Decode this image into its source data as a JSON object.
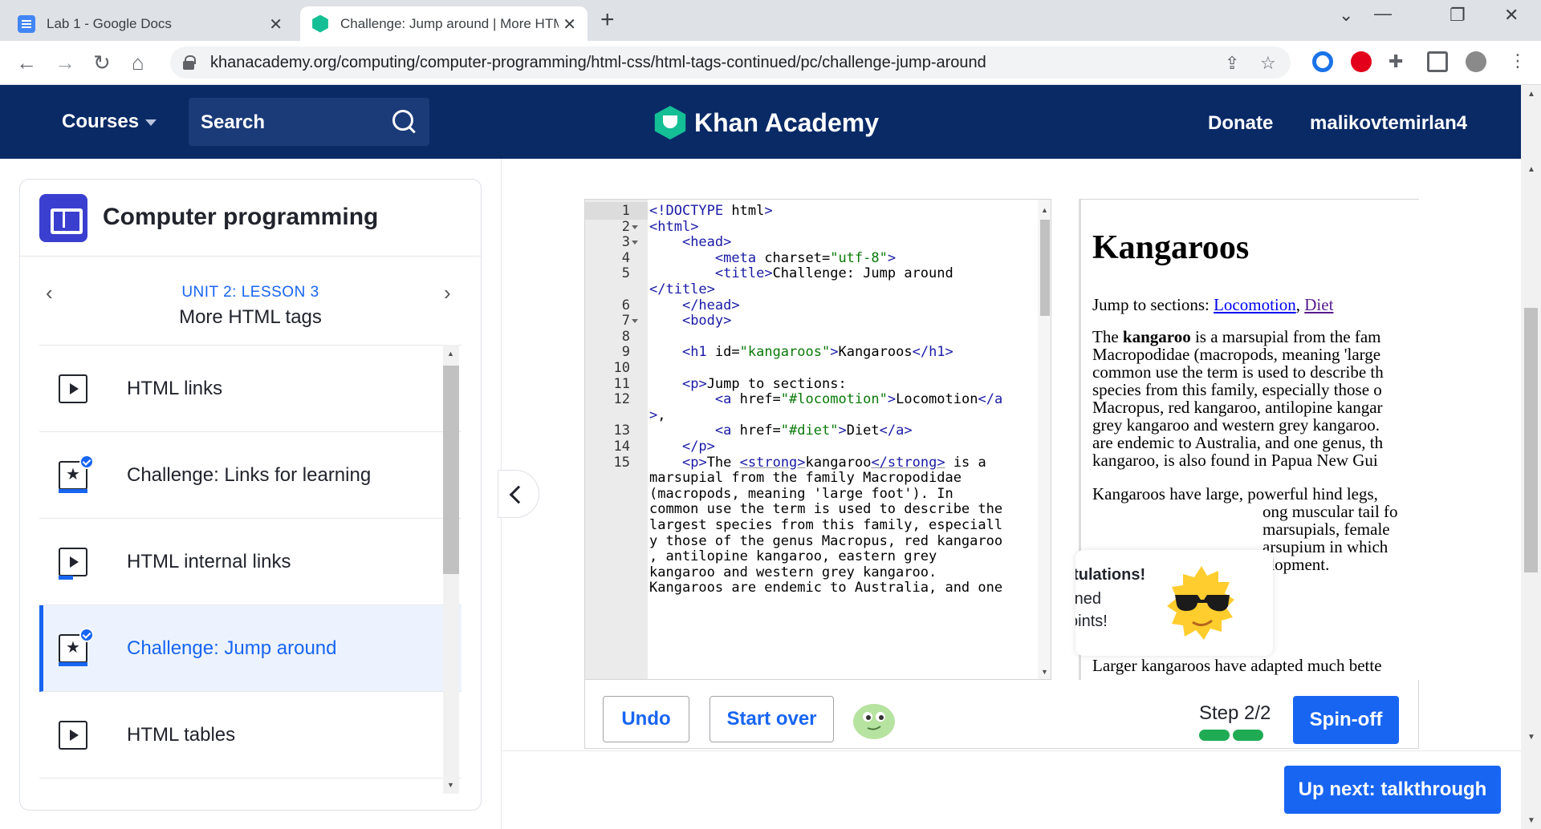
{
  "browser": {
    "tabs": [
      {
        "title": "Lab 1 - Google Docs",
        "favicon": "google-docs-icon"
      },
      {
        "title": "Challenge: Jump around | More HTML tags",
        "favicon": "khan-academy-icon"
      }
    ],
    "url": "khanacademy.org/computing/computer-programming/html-css/html-tags-continued/pc/challenge-jump-around"
  },
  "header": {
    "courses_label": "Courses",
    "search_label": "Search",
    "logo_text": "Khan Academy",
    "donate_label": "Donate",
    "username": "malikovtemirlan4",
    "bg_color": "#0a2a66"
  },
  "sidebar": {
    "course_title": "Computer programming",
    "unit_label": "UNIT 2: LESSON 3",
    "lesson_title": "More HTML tags",
    "items": [
      {
        "label": "HTML links",
        "type": "video",
        "completed": false
      },
      {
        "label": "Challenge: Links for learning",
        "type": "challenge",
        "completed": true
      },
      {
        "label": "HTML internal links",
        "type": "video",
        "completed": false
      },
      {
        "label": "Challenge: Jump around",
        "type": "challenge",
        "completed": true,
        "active": true
      },
      {
        "label": "HTML tables",
        "type": "video",
        "completed": false
      }
    ]
  },
  "editor": {
    "line_numbers": [
      "1",
      "2",
      "3",
      "4",
      "5",
      "",
      "6",
      "7",
      "8",
      "9",
      "10",
      "11",
      "12",
      "",
      "13",
      "14",
      "15"
    ],
    "code_lines": [
      "<!DOCTYPE html>",
      "<html>",
      "    <head>",
      "        <meta charset=\"utf-8\">",
      "        <title>Challenge: Jump around",
      "</title>",
      "    </head>",
      "    <body>",
      "",
      "    <h1 id=\"kangaroos\">Kangaroos</h1>",
      "",
      "    <p>Jump to sections:",
      "        <a href=\"#locomotion\">Locomotion</a",
      ">,",
      "        <a href=\"#diet\">Diet</a>",
      "    </p>",
      "    <p>The <strong>kangaroo</strong> is a",
      "marsupial from the family Macropodidae",
      "(macropods, meaning 'large foot'). In",
      "common use the term is used to describe the",
      "largest species from this family, especiall",
      "y those of the genus Macropus, red kangaroo",
      ", antilopine kangaroo, eastern grey",
      "kangaroo and western grey kangaroo.",
      "Kangaroos are endemic to Australia, and one"
    ]
  },
  "preview": {
    "heading": "Kangaroos",
    "jump_prefix": "Jump to sections: ",
    "link_locomotion": "Locomotion",
    "link_sep": ",",
    "link_diet": "Diet",
    "para1_lines": [
      "The kangaroo is a marsupial from the fam",
      "Macropodidae (macropods, meaning 'large",
      "common use the term is used to describe th",
      "species from this family, especially those o",
      "Macropus, red kangaroo, antilopine kangar",
      "grey kangaroo and western grey kangaroo.",
      "are endemic to Australia, and one genus, th",
      "kangaroo, is also found in Papua New Gui"
    ],
    "para2_lines": [
      "Kangaroos have large, powerful hind legs,",
      "ong muscular tail fo",
      "marsupials, female",
      "arsupium in which",
      "elopment."
    ],
    "para3_line": "Larger kangaroos have adapted much bette"
  },
  "congrats": {
    "heading": "atulations!",
    "line1": "rned",
    "line2": "oints!"
  },
  "bottom": {
    "undo_label": "Undo",
    "start_over_label": "Start over",
    "step_label": "Step 2/2",
    "spinoff_label": "Spin-off",
    "up_next_label": "Up next: talkthrough"
  },
  "colors": {
    "ka_blue": "#1865f2",
    "ka_green": "#14bf96",
    "step_green": "#1fab54"
  }
}
